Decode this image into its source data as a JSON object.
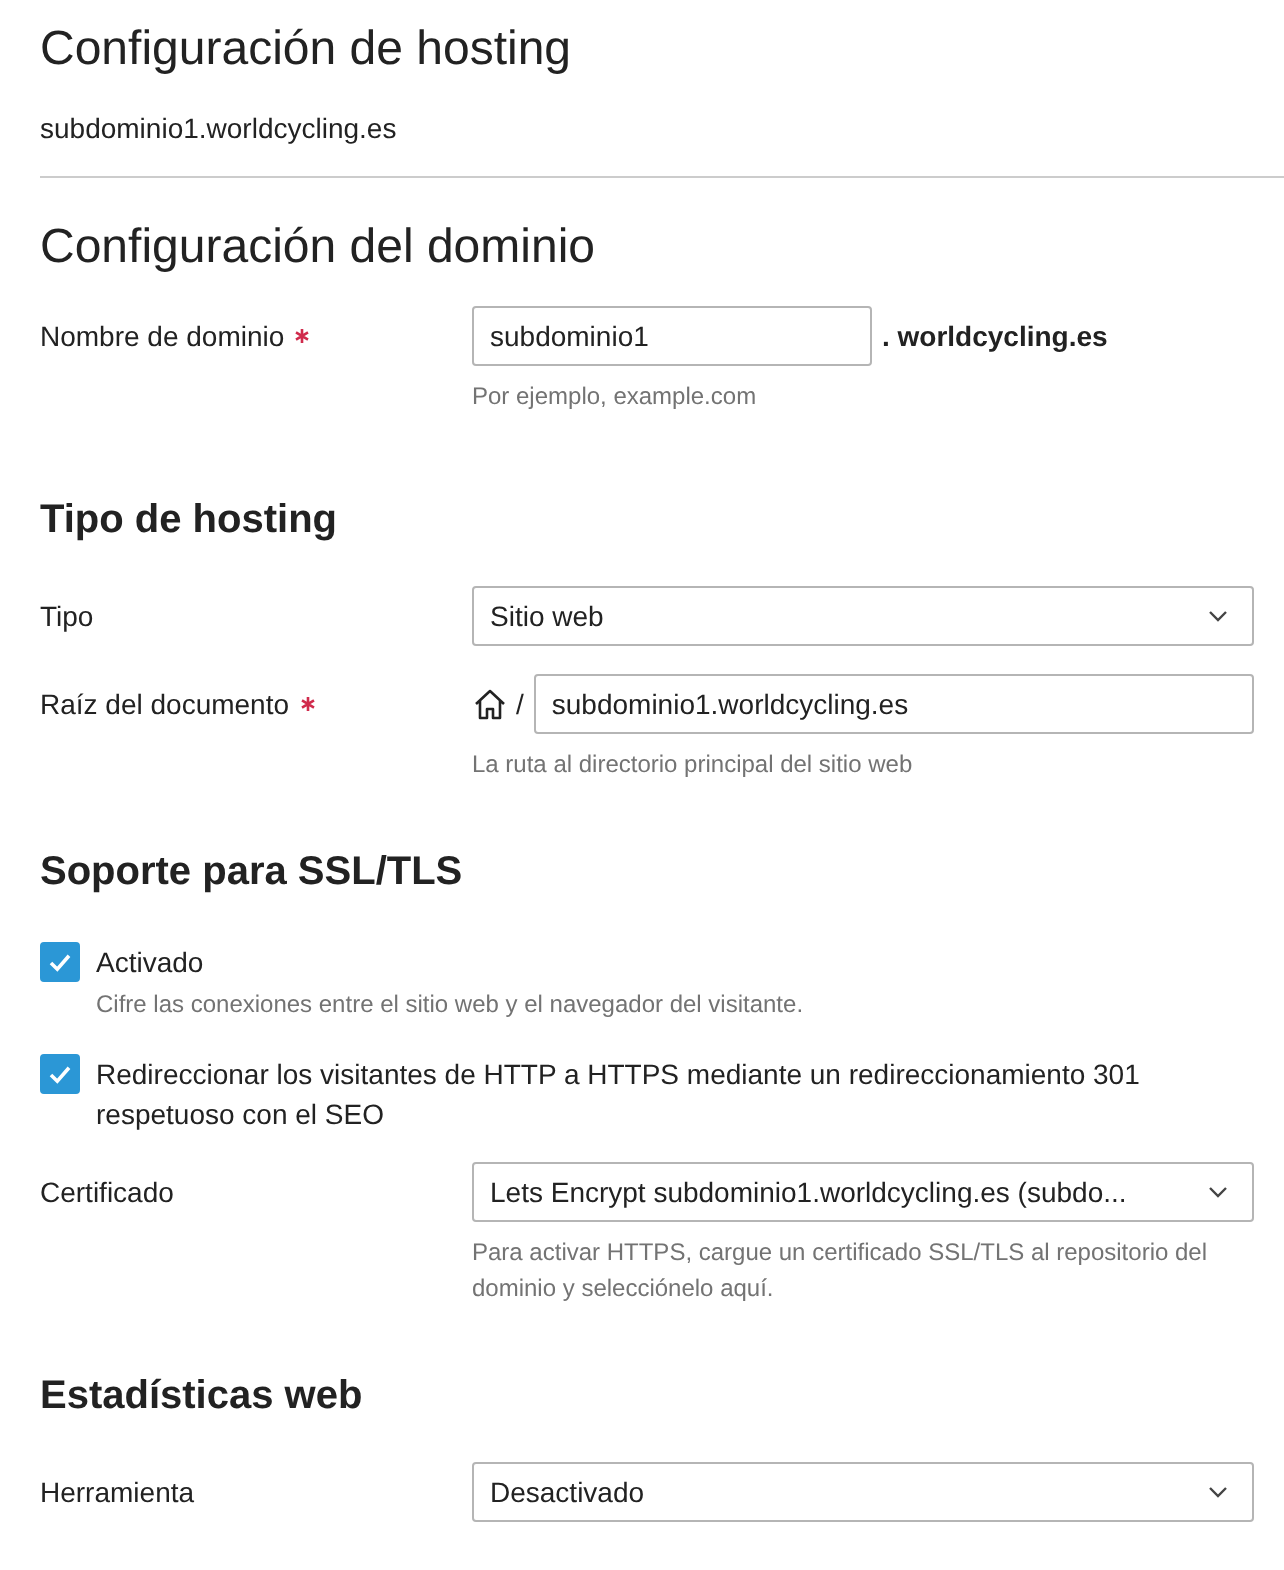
{
  "header": {
    "title": "Configuración de hosting",
    "subtitle": "subdominio1.worldcycling.es"
  },
  "sections": [
    {
      "title": "Configuración del dominio",
      "kind": "main",
      "rows": [
        {
          "kind": "domain",
          "label": "Nombre de dominio",
          "required": true,
          "value": "subdominio1",
          "suffix": ". worldcycling.es",
          "hint": "Por ejemplo, example.com"
        }
      ]
    },
    {
      "title": "Tipo de hosting",
      "kind": "group",
      "rows": [
        {
          "kind": "select",
          "label": "Tipo",
          "required": false,
          "value": "Sitio web"
        },
        {
          "kind": "path",
          "label": "Raíz del documento",
          "required": true,
          "prefix": "/",
          "value": "subdominio1.worldcycling.es",
          "hint": "La ruta al directorio principal del sitio web"
        }
      ]
    },
    {
      "title": "Soporte para SSL/TLS",
      "kind": "group",
      "rows": [
        {
          "kind": "checkbox",
          "label": "Activado",
          "checked": true,
          "hint": "Cifre las conexiones entre el sitio web y el navegador del visitante."
        },
        {
          "kind": "checkbox",
          "label": "Redireccionar los visitantes de HTTP a HTTPS mediante un redireccionamiento 301 respetuoso con el SEO",
          "checked": true
        },
        {
          "kind": "select",
          "label": "Certificado",
          "required": false,
          "value": "Lets Encrypt subdominio1.worldcycling.es (subdo...",
          "hint": "Para activar HTTPS, cargue un certificado SSL/TLS al repositorio del dominio y selecciónelo aquí."
        }
      ]
    },
    {
      "title": "Estadísticas web",
      "kind": "group",
      "rows": [
        {
          "kind": "select",
          "label": "Herramienta",
          "required": false,
          "value": "Desactivado"
        }
      ]
    }
  ]
}
